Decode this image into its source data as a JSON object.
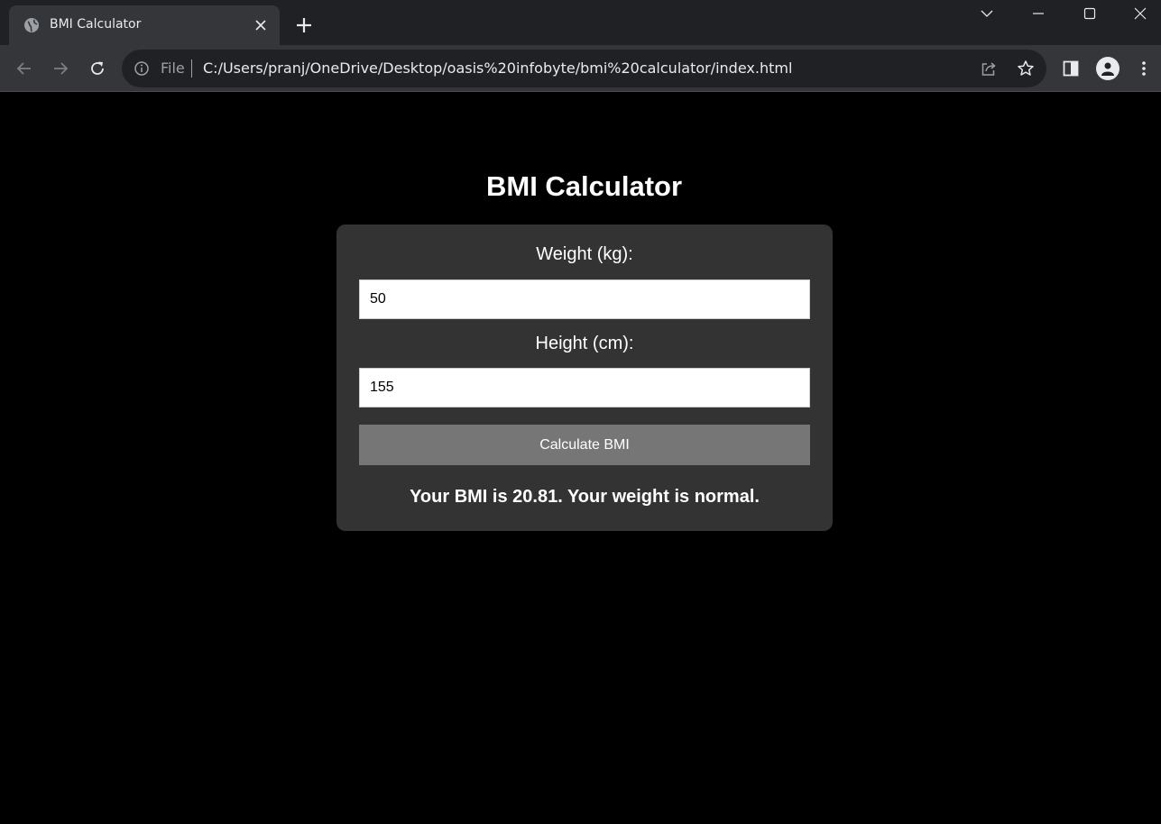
{
  "browser": {
    "tab_title": "BMI Calculator",
    "address_scheme_label": "File",
    "url": "C:/Users/pranj/OneDrive/Desktop/oasis%20infobyte/bmi%20calculator/index.html"
  },
  "app": {
    "title": "BMI Calculator",
    "weight_label": "Weight (kg):",
    "weight_value": "50",
    "height_label": "Height (cm):",
    "height_value": "155",
    "calculate_label": "Calculate BMI",
    "result_text": "Your BMI is 20.81. Your weight is normal."
  },
  "colors": {
    "page_background": "#000000",
    "card_background": "#333333",
    "button_background": "#767676"
  }
}
